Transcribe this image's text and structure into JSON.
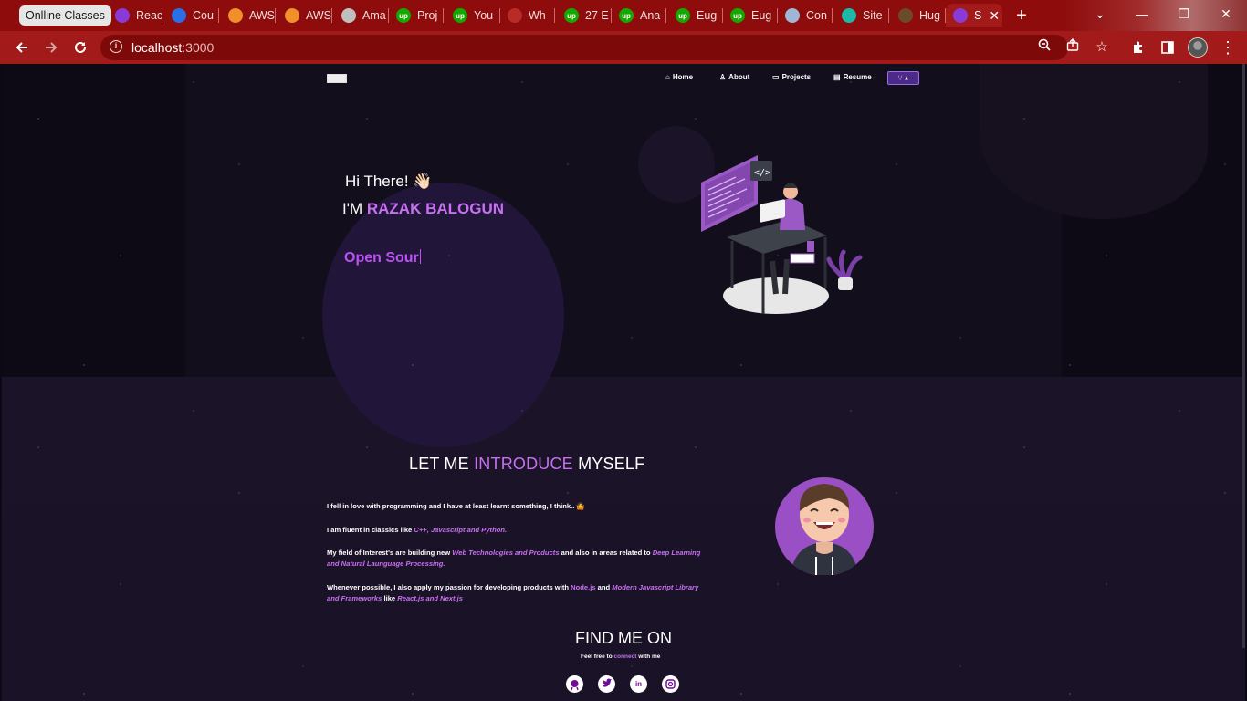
{
  "browser": {
    "tab_group": "Onlline Classes",
    "tabs": [
      {
        "label": "Reac",
        "icon": "u-icon",
        "color": "#8a3ad8"
      },
      {
        "label": "Cou",
        "icon": "c-icon",
        "color": "#2a6ee8"
      },
      {
        "label": "AWS",
        "icon": "aws-cube-icon",
        "color": "#f0902a"
      },
      {
        "label": "AWS",
        "icon": "aws-cube-icon",
        "color": "#f0902a"
      },
      {
        "label": "Ama",
        "icon": "globe-icon",
        "color": "#bfbfbf"
      },
      {
        "label": "Proj",
        "icon": "upwork-icon",
        "color": "#14a800"
      },
      {
        "label": "You",
        "icon": "upwork-icon",
        "color": "#14a800"
      },
      {
        "label": "Wh",
        "icon": "quora-icon",
        "color": "#b92b27"
      },
      {
        "label": "27 E",
        "icon": "upwork-icon",
        "color": "#14a800"
      },
      {
        "label": "Ana",
        "icon": "upwork-icon",
        "color": "#14a800"
      },
      {
        "label": "Eug",
        "icon": "upwork-icon",
        "color": "#14a800"
      },
      {
        "label": "Eug",
        "icon": "upwork-icon",
        "color": "#14a800"
      },
      {
        "label": "Con",
        "icon": "glasses-icon",
        "color": "#9fb6d6"
      },
      {
        "label": "Site",
        "icon": "diamond-icon",
        "color": "#1cb8a8"
      },
      {
        "label": "Hug",
        "icon": "image-icon",
        "color": "#6b4a2a"
      },
      {
        "label": "S",
        "icon": "site-icon",
        "color": "#8a3ad8"
      }
    ],
    "url_host": "localhost",
    "url_port": ":3000"
  },
  "nav": {
    "home": "Home",
    "about": "About",
    "projects": "Projects",
    "resume": "Resume",
    "star_button": "⑂ ★"
  },
  "hero": {
    "greeting": "Hi There! 👋🏻",
    "im": "I'M ",
    "name": "RAZAK BALOGUN",
    "typed": "Open Sour"
  },
  "about": {
    "title_a": "LET ME ",
    "title_b": "INTRODUCE",
    "title_c": " MYSELF",
    "p1": "I fell in love with programming and I have at least learnt something, I think.. 🤷",
    "p2_a": "I am fluent in classics like ",
    "p2_b": "C++, Javascript and Python.",
    "p3_a": "My field of Interest's are building new ",
    "p3_b": " Web Technologies and Products",
    "p3_c": " and also in areas related to ",
    "p3_d": "Deep Learning and Natural Launguage Processing.",
    "p4_a": "Whenever possible, I also apply my passion for developing products with ",
    "p4_b": "Node.js",
    "p4_c": " and ",
    "p4_d": "Modern Javascript Library and Frameworks",
    "p4_e": " like ",
    "p4_f": "React.js and Next.js"
  },
  "find": {
    "title": "FIND ME ON",
    "sub_a": "Feel free to ",
    "sub_b": "connect",
    "sub_c": " with me",
    "icons": [
      "github-icon",
      "twitter-icon",
      "linkedin-icon",
      "instagram-icon"
    ]
  },
  "colors": {
    "accent": "#c770f0",
    "chrome": "#a31a1a"
  }
}
